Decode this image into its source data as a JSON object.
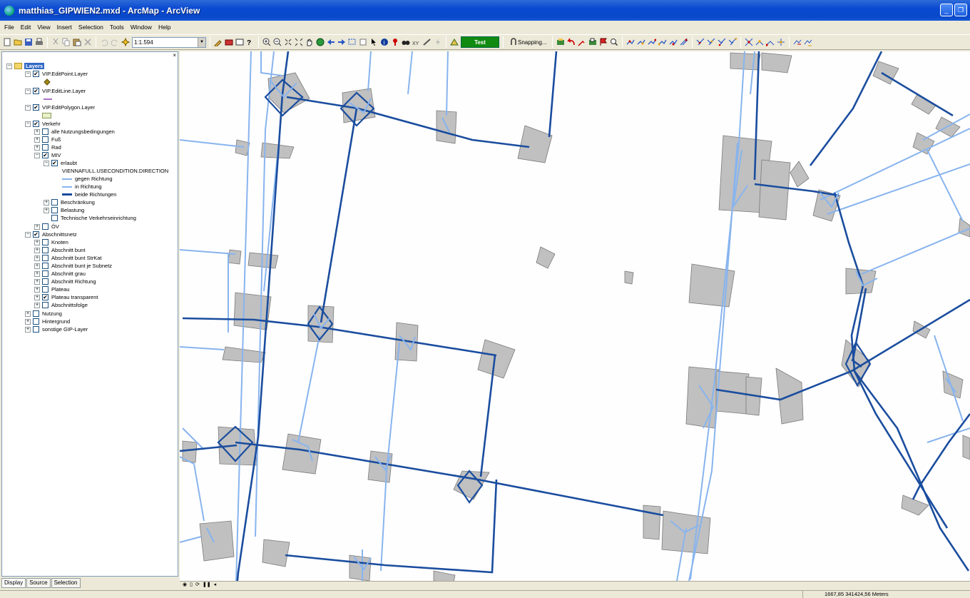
{
  "window": {
    "title": "matthias_GIPWIEN2.mxd - ArcMap - ArcView",
    "minimize": "_",
    "restore": "❐"
  },
  "menu": [
    "File",
    "Edit",
    "View",
    "Insert",
    "Selection",
    "Tools",
    "Window",
    "Help"
  ],
  "toolbar": {
    "scale": "1:1.594",
    "test_label": "Test",
    "snapping_label": "Snapping..."
  },
  "toc": {
    "close": "×",
    "rows": [
      {
        "label": "Layers",
        "expander": "−",
        "checkbox": null,
        "kind": "root"
      },
      {
        "label": "VIP.EditPoint.Layer",
        "expander": "−",
        "checkbox": "✔"
      },
      {
        "label": "VIP.EditLine.Layer",
        "expander": "−",
        "checkbox": "✔"
      },
      {
        "label": "VIP.EditPolygon.Layer",
        "expander": "−",
        "checkbox": "✔"
      },
      {
        "label": "Verkehr",
        "expander": "−",
        "checkbox": "✔"
      },
      {
        "label": "alle Nutzungsbedingungen",
        "expander": "+",
        "checkbox": ""
      },
      {
        "label": "Fuß",
        "expander": "+",
        "checkbox": ""
      },
      {
        "label": "Rad",
        "expander": "+",
        "checkbox": ""
      },
      {
        "label": "MIV",
        "expander": "−",
        "checkbox": "✔"
      },
      {
        "label": "erlaubt",
        "expander": "−",
        "checkbox": "✔"
      },
      {
        "label": "VIENNAFULL.USECONDITION.DIRECTION",
        "kind": "field"
      },
      {
        "label": "gegen Richtung",
        "kind": "legend",
        "color": "#88b4ee"
      },
      {
        "label": "in Richtung",
        "kind": "legend",
        "color": "#88b4ee"
      },
      {
        "label": "beide Richtungen",
        "kind": "legend",
        "color": "#1a4d9e"
      },
      {
        "label": "Beschränkung",
        "expander": "+",
        "checkbox": ""
      },
      {
        "label": "Belastung",
        "expander": "+",
        "checkbox": ""
      },
      {
        "label": "Technische Verkehrseinrichtung",
        "checkbox": ""
      },
      {
        "label": "ÖV",
        "expander": "+",
        "checkbox": ""
      },
      {
        "label": "Abschnittsnetz",
        "expander": "−",
        "checkbox": "✔"
      },
      {
        "label": "Knoten",
        "expander": "+",
        "checkbox": ""
      },
      {
        "label": "Abschnitt bunt",
        "expander": "+",
        "checkbox": ""
      },
      {
        "label": "Abschnitt bunt StrKat",
        "expander": "+",
        "checkbox": ""
      },
      {
        "label": "Abschnitt bunt je Subnetz",
        "expander": "+",
        "checkbox": ""
      },
      {
        "label": "Abschnitt grau",
        "expander": "+",
        "checkbox": ""
      },
      {
        "label": "Abschnitt Richtung",
        "expander": "+",
        "checkbox": ""
      },
      {
        "label": "Plateau",
        "expander": "+",
        "checkbox": ""
      },
      {
        "label": "Plateau transparent",
        "expander": "+",
        "checkbox": "✔"
      },
      {
        "label": "Abschnittsfolge",
        "expander": "+",
        "checkbox": ""
      },
      {
        "label": "Nutzung",
        "expander": "+",
        "checkbox": ""
      },
      {
        "label": "Hintergrund",
        "expander": "+",
        "checkbox": ""
      },
      {
        "label": "sonstige GIP-Layer",
        "expander": "+",
        "checkbox": ""
      }
    ],
    "tabs": [
      "Display",
      "Source",
      "Selection"
    ]
  },
  "status": {
    "coordinates": "1667,85  341424,56 Meters"
  },
  "colors": {
    "one_way": "#88b4ee",
    "both_ways": "#1a4d9e",
    "plateau_fill": "#c0c0c0"
  }
}
